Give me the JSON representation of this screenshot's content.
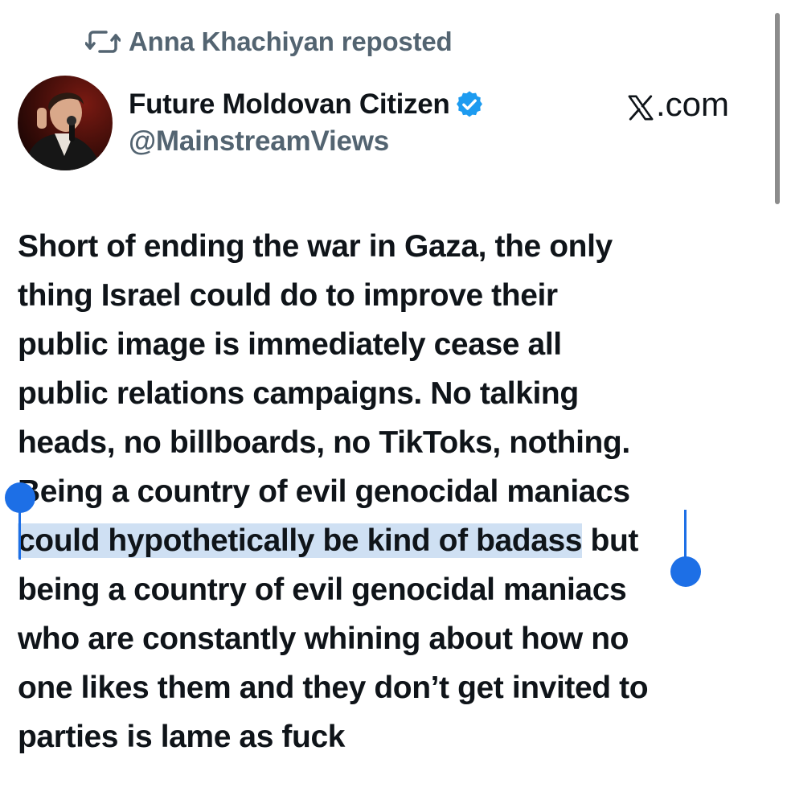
{
  "repost": {
    "icon": "repost-icon",
    "text": "Anna Khachiyan reposted"
  },
  "author": {
    "avatar": "avatar",
    "display_name": "Future Moldovan Citizen",
    "verified_icon": "verified-badge-icon",
    "handle": "@MainstreamViews"
  },
  "site": {
    "logo": "x-logo-icon",
    "label": ".com"
  },
  "tweet": {
    "lines": [
      "Short of ending the war in Gaza, the only",
      "thing Israel could do to improve their",
      "public image is immediately cease all",
      "public relations campaigns. No talking",
      "heads, no billboards, no TikToks, nothing."
    ],
    "line6": "Being a country of evil genocidal maniacs",
    "line7_selected": "could hypothetically be kind of badass",
    "line7_rest": " but",
    "lines_after": [
      "being a country of evil genocidal maniacs",
      "who are constantly whining about how no",
      "one likes them and they don’t get invited to",
      "parties is lame as fuck"
    ]
  },
  "colors": {
    "text": "#0f1419",
    "secondary": "#536471",
    "verified": "#1d9bf0",
    "selection_bg": "#cfe0f3",
    "selection_handle": "#1d6fe6"
  }
}
